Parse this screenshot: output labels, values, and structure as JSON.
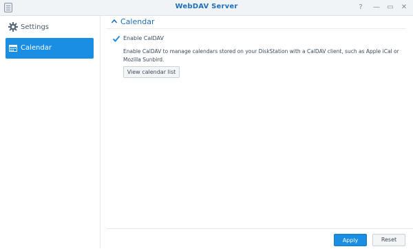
{
  "window": {
    "title": "WebDAV Server",
    "controls": {
      "help": "?",
      "minimize": "—",
      "maximize": "▭",
      "close": "✕"
    }
  },
  "sidebar": {
    "items": [
      {
        "label": "Settings",
        "icon": "gear-icon",
        "selected": false
      },
      {
        "label": "Calendar",
        "icon": "calendar-icon",
        "selected": true
      }
    ]
  },
  "main": {
    "section_title": "Calendar",
    "enable_caldav": {
      "label": "Enable CalDAV",
      "checked": true
    },
    "description": "Enable CalDAV to manage calendars stored on your DiskStation with a CalDAV client, such as Apple iCal or Mozilla Sunbird.",
    "view_button": "View calendar list"
  },
  "footer": {
    "apply": "Apply",
    "reset": "Reset"
  },
  "colors": {
    "accent": "#1a8ee3",
    "title": "#1e6fb8"
  }
}
